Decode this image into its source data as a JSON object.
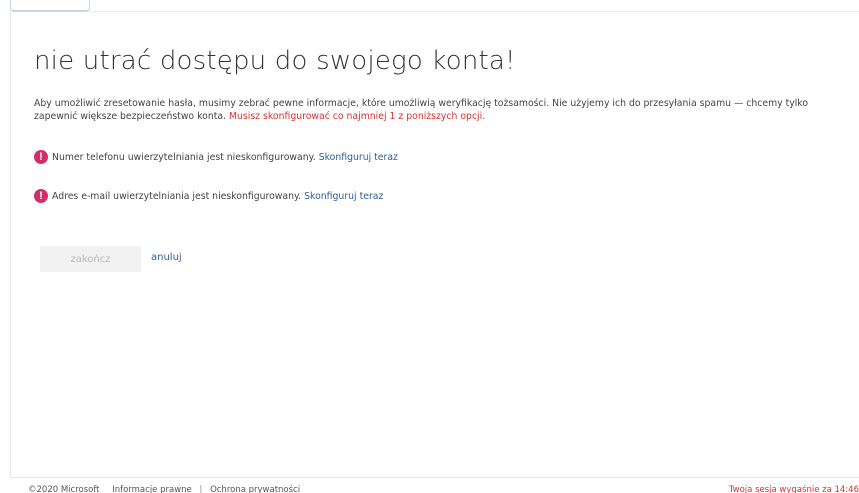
{
  "page": {
    "title": "nie utrać dostępu do swojego konta!",
    "intro_text": "Aby umożliwić zresetowanie hasła, musimy zebrać pewne informacje, które umożliwią weryfikację tożsamości. Nie użyjemy ich do przesyłania spamu — chcemy tylko zapewnić większe bezpieczeństwo konta.",
    "intro_required": "Musisz skonfigurować co najmniej 1 z poniższych opcji."
  },
  "alerts": [
    {
      "icon": "exclamation-icon",
      "text": "Numer telefonu uwierzytelniania jest nieskonfigurowany.",
      "link": "Skonfiguruj teraz"
    },
    {
      "icon": "exclamation-icon",
      "text": "Adres e-mail uwierzytelniania jest nieskonfigurowany.",
      "link": "Skonfiguruj teraz"
    }
  ],
  "actions": {
    "finish_label": "zakończ",
    "cancel_label": "anuluj"
  },
  "footer": {
    "copyright": "©2020 Microsoft",
    "legal_link": "Informacje prawne",
    "separator": "|",
    "privacy_link": "Ochrona prywatności",
    "session_text": "Twoja sesja wygaśnie za 14:46"
  },
  "colors": {
    "alert_icon": "#d12f6a",
    "required_text": "#d1342f",
    "link": "#2f5f98",
    "disabled_button_bg": "#f2f2f2"
  }
}
